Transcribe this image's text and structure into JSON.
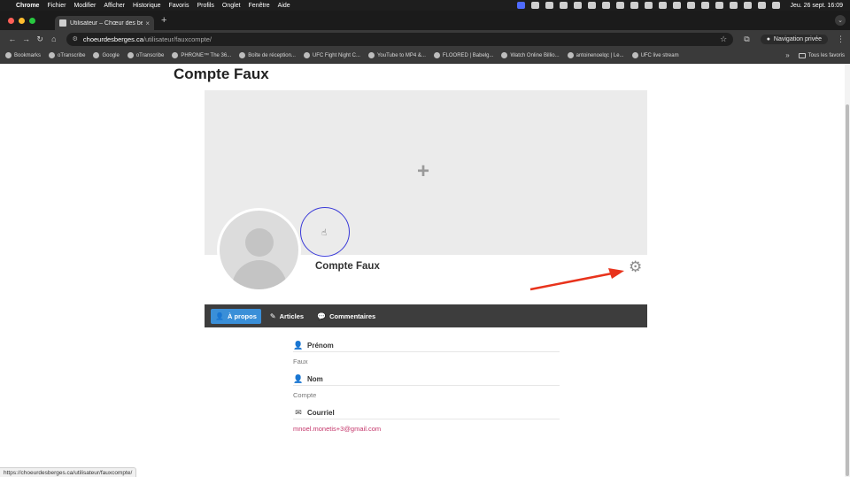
{
  "menubar": {
    "app": "Chrome",
    "items": [
      "Fichier",
      "Modifier",
      "Afficher",
      "Historique",
      "Favoris",
      "Profils",
      "Onglet",
      "Fenêtre",
      "Aide"
    ],
    "clock": "Jeu. 26 sept.  16:09"
  },
  "browser": {
    "tab_title": "Utilisateur – Chœur des berg",
    "tab_close": "×",
    "new_tab": "+",
    "url_host": "choeurdesberges.ca",
    "url_path": "/utilisateur/fauxcompte/",
    "private_label": "Navigation privée",
    "traffic_colors": [
      "#ff5f57",
      "#febc2e",
      "#28c840"
    ]
  },
  "bookmarks": {
    "items": [
      "Bookmarks",
      "oTranscribe",
      "Google",
      "oTranscribe",
      "PHRONE™ The 36...",
      "Boîte de réception...",
      "UFC Fight Night C...",
      "YouTube to MP4 &...",
      "FLOORED | Babelg...",
      "Watch Online Billio...",
      "antoinenoelqc | Le...",
      "UFC live stream"
    ],
    "more": "»",
    "all_label": "Tous les favoris"
  },
  "page": {
    "title": "Compte Faux",
    "profile_name": "Compte Faux",
    "tabs": [
      {
        "label": "À propos",
        "icon": "user-icon",
        "active": true
      },
      {
        "label": "Articles",
        "icon": "pencil-icon",
        "active": false
      },
      {
        "label": "Commentaires",
        "icon": "comment-icon",
        "active": false
      }
    ],
    "fields": [
      {
        "label": "Prénom",
        "value": "Faux",
        "icon": "user-icon"
      },
      {
        "label": "Nom",
        "value": "Compte",
        "icon": "user-icon"
      },
      {
        "label": "Courriel",
        "value": "mnoel.monetis+3@gmail.com",
        "icon": "envelope-icon"
      }
    ],
    "accent": "#3a8fd8",
    "arrow_color": "#e8331c"
  },
  "status_bar": {
    "url": "https://choeurdesberges.ca/utilisateur/fauxcompte/"
  }
}
